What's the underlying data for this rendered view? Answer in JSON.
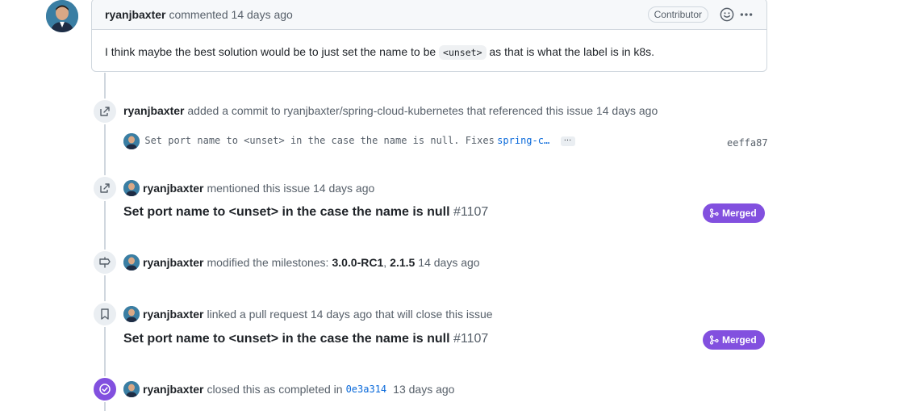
{
  "comment": {
    "author": "ryanjbaxter",
    "action": "commented",
    "time": "14 days ago",
    "badge": "Contributor",
    "body_before": "I think maybe the best solution would be to just set the name to be",
    "body_code": "<unset>",
    "body_after": "as that is what the label is in k8s."
  },
  "events": {
    "commit_ref": {
      "author": "ryanjbaxter",
      "text": "added a commit to ryanjbaxter/spring-cloud-kubernetes that referenced this issue 14 days ago",
      "commit_message": "Set port name to <unset> in the case the name is null. Fixes",
      "commit_link": "spring-c…",
      "ellipsis": "…",
      "sha": "eeffa87"
    },
    "mention": {
      "author": "ryanjbaxter",
      "text": "mentioned this issue 14 days ago",
      "pr_title": "Set port name to <unset> in the case the name is null",
      "pr_number": "#1107",
      "badge": "Merged"
    },
    "milestone": {
      "author": "ryanjbaxter",
      "text_before": "modified the milestones:",
      "m1": "3.0.0-RC1",
      "sep": ",",
      "m2": "2.1.5",
      "time": "14 days ago"
    },
    "linked_pr": {
      "author": "ryanjbaxter",
      "text": "linked a pull request 14 days ago that will close this issue",
      "pr_title": "Set port name to <unset> in the case the name is null",
      "pr_number": "#1107",
      "badge": "Merged"
    },
    "closed": {
      "author": "ryanjbaxter",
      "text": "closed this as completed in",
      "sha": "0e3a314",
      "time": "13 days ago"
    }
  },
  "colors": {
    "merged": "#8250df",
    "link": "#0969da",
    "muted": "#57606a",
    "border": "#d0d7de"
  }
}
